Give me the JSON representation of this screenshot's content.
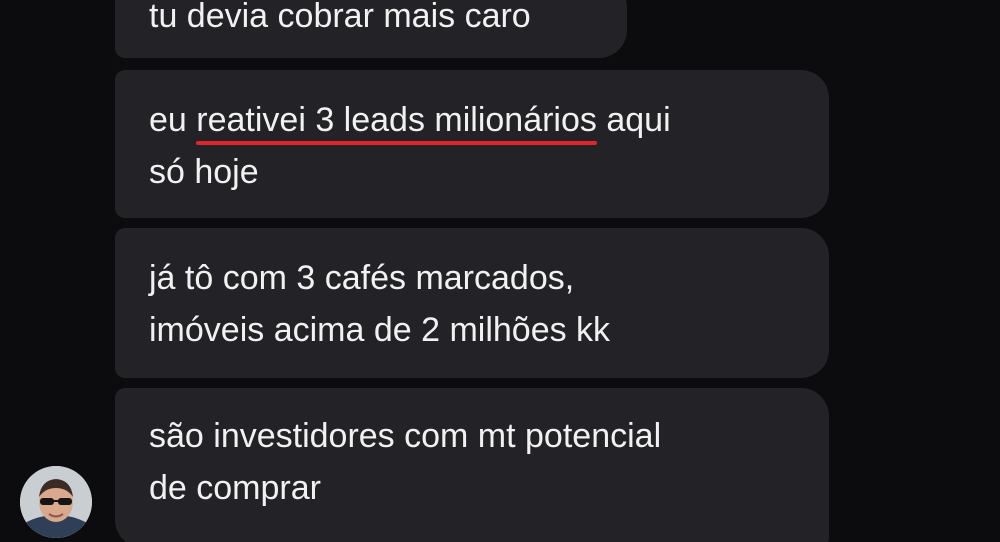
{
  "messages": [
    {
      "text": "tu devia cobrar mais caro"
    },
    {
      "before": "eu ",
      "highlight": "reativei 3 leads milionários",
      "after_line1": " aqui",
      "line2": "só hoje"
    },
    {
      "line1": "já tô com 3 cafés marcados,",
      "line2": "imóveis acima de 2 milhões kk"
    },
    {
      "line1": "são investidores com mt potencial",
      "line2": "de comprar"
    }
  ],
  "colors": {
    "background": "#0c0c0e",
    "bubble": "#232327",
    "text": "#f1f1f1",
    "underline": "#e2242b"
  },
  "icons": {
    "avatar": "profile-photo"
  }
}
